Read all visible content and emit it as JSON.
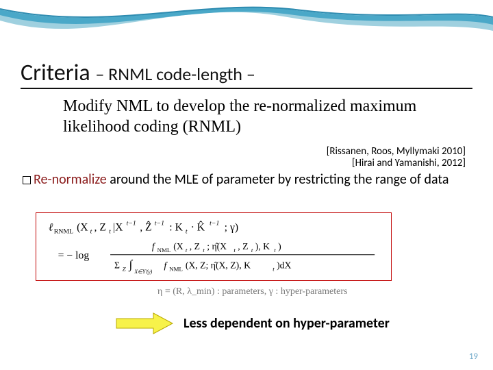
{
  "title": {
    "main": "Criteria ",
    "sub": "– RNML code-length –"
  },
  "subtitle": "Modify NML to develop the re-normalized maximum likelihood coding (RNML)",
  "citations": [
    "[Rissanen, Roos, Myllymaki 2010]",
    "[Hirai and Yamanishi, 2012]"
  ],
  "renorm": {
    "lead": "Re-normalize",
    "rest": " around the MLE of parameter by restricting the range of data"
  },
  "formula": {
    "line1": "ℓ_RNML(X_t, Z_t | X^{t−1}, Ẑ^{t−1} : K_t · K̂^{t−1} ; γ)",
    "line2": "= − log",
    "numerator": "f_NML(X_t, Z_t ; η̂(X_t, Z_t), K_t)",
    "denominator": "Σ_Z ∫_{X∈Y'(γ)} f_NML(X, Z; η̂(X, Z), K_t) dX"
  },
  "params_note": "η = (R, λ_min) : parameters,  γ : hyper-parameters",
  "hyper_text": "Less dependent on hyper-parameter",
  "page_number": "19"
}
